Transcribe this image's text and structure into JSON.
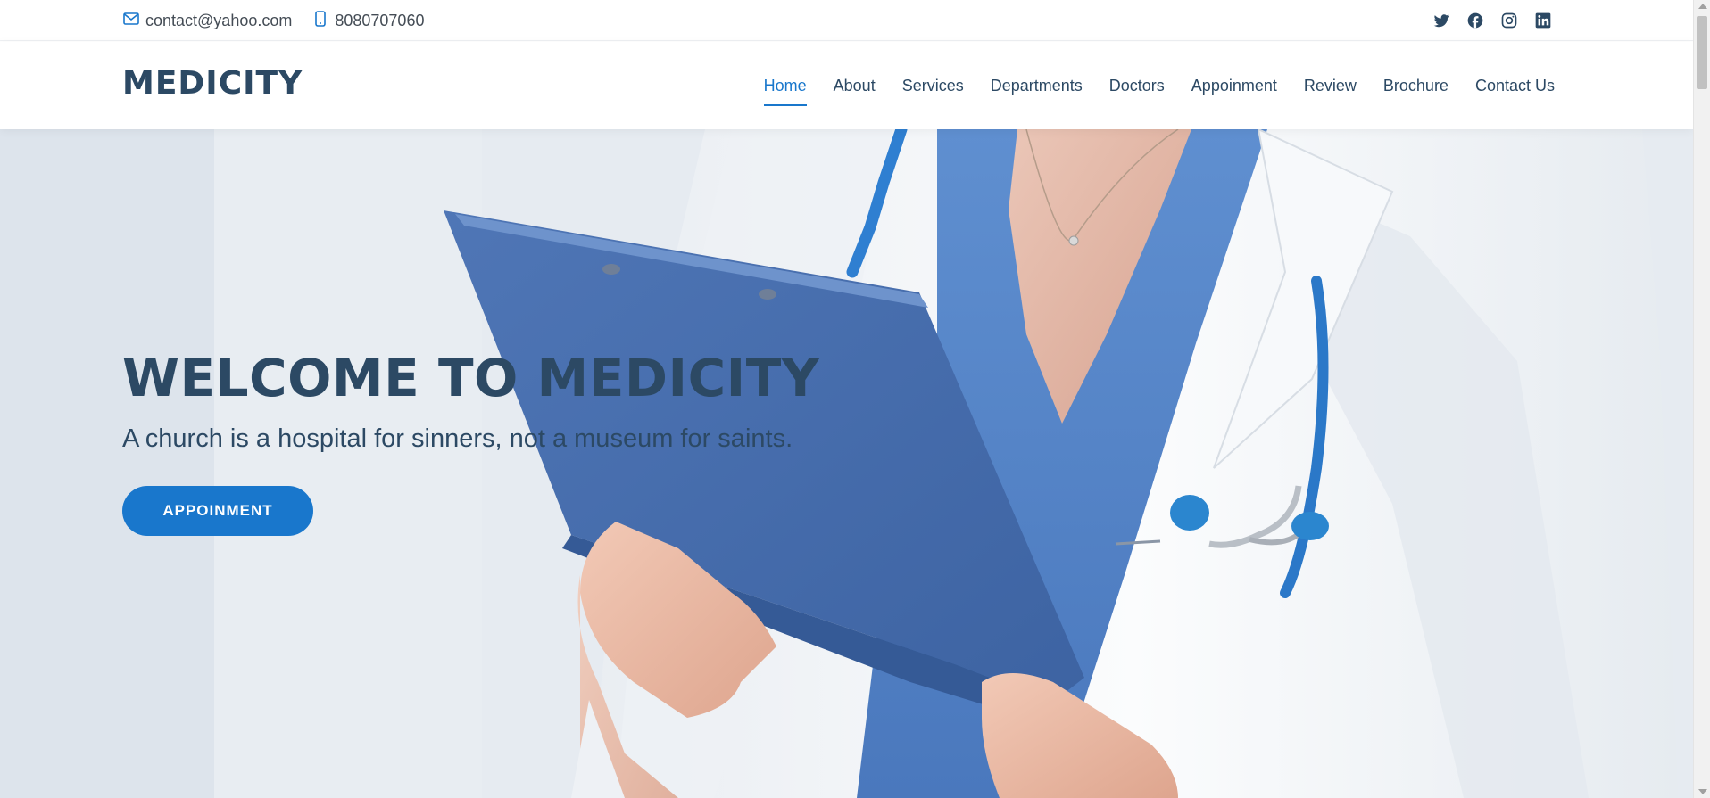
{
  "topbar": {
    "email": "contact@yahoo.com",
    "phone": "8080707060",
    "social": [
      {
        "icon": "twitter-icon"
      },
      {
        "icon": "facebook-icon"
      },
      {
        "icon": "instagram-icon"
      },
      {
        "icon": "linkedin-icon"
      }
    ]
  },
  "header": {
    "logo": "MEDICITY",
    "nav": [
      {
        "label": "Home",
        "active": true
      },
      {
        "label": "About"
      },
      {
        "label": "Services"
      },
      {
        "label": "Departments"
      },
      {
        "label": "Doctors"
      },
      {
        "label": "Appoinment"
      },
      {
        "label": "Review"
      },
      {
        "label": "Brochure"
      },
      {
        "label": "Contact Us"
      }
    ]
  },
  "hero": {
    "title": "WELCOME TO MEDICITY",
    "subtitle": "A church is a hospital for sinners, not a museum for saints.",
    "button": "APPOINMENT"
  },
  "colors": {
    "primary": "#1977cc",
    "heading": "#2c4964",
    "text": "#444c55"
  }
}
